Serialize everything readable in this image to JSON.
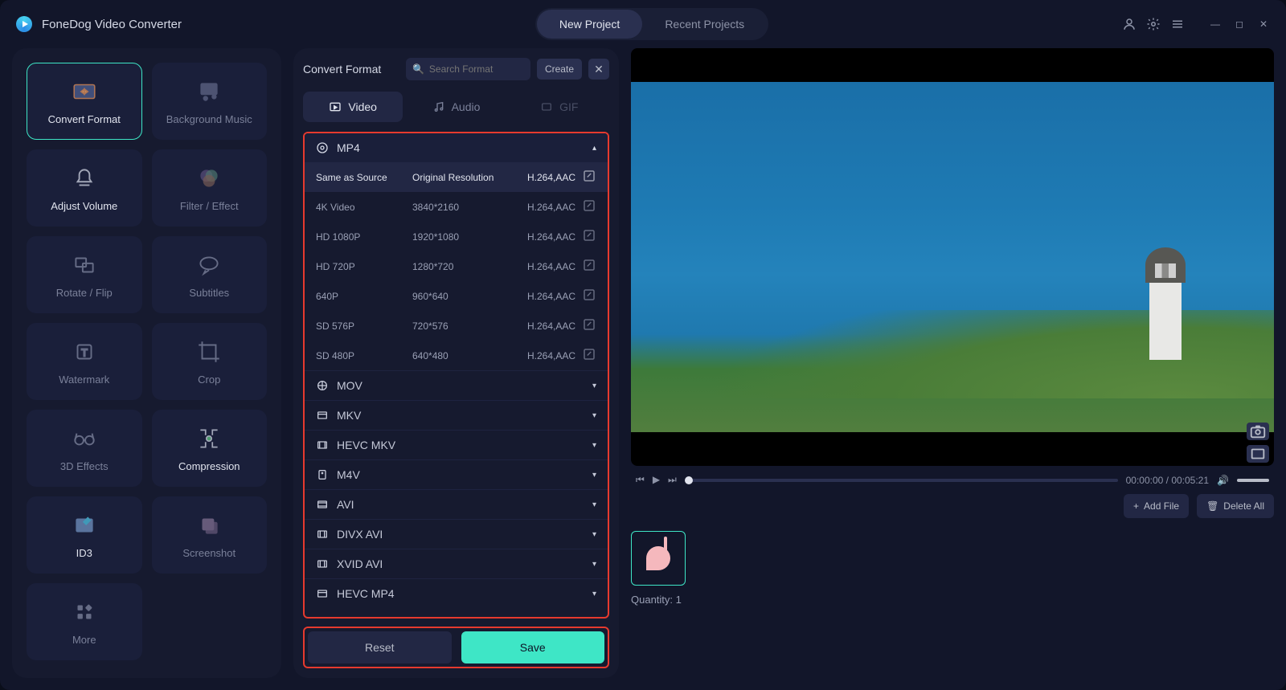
{
  "app": {
    "title": "FoneDog Video Converter"
  },
  "header": {
    "tabs": {
      "new": "New Project",
      "recent": "Recent Projects"
    }
  },
  "sidebar": {
    "items": [
      {
        "label": "Convert Format",
        "state": "active"
      },
      {
        "label": "Background Music",
        "state": ""
      },
      {
        "label": "Adjust Volume",
        "state": "highlight"
      },
      {
        "label": "Filter / Effect",
        "state": ""
      },
      {
        "label": "Rotate / Flip",
        "state": ""
      },
      {
        "label": "Subtitles",
        "state": ""
      },
      {
        "label": "Watermark",
        "state": ""
      },
      {
        "label": "Crop",
        "state": ""
      },
      {
        "label": "3D Effects",
        "state": ""
      },
      {
        "label": "Compression",
        "state": "highlight"
      },
      {
        "label": "ID3",
        "state": "highlight"
      },
      {
        "label": "Screenshot",
        "state": ""
      },
      {
        "label": "More",
        "state": ""
      }
    ]
  },
  "panel": {
    "title": "Convert Format",
    "search_placeholder": "Search Format",
    "create": "Create",
    "tabs": {
      "video": "Video",
      "audio": "Audio",
      "gif": "GIF"
    },
    "mp4_header": "MP4",
    "presets": [
      {
        "name": "Same as Source",
        "res": "Original Resolution",
        "codec": "H.264,AAC",
        "sel": true
      },
      {
        "name": "4K Video",
        "res": "3840*2160",
        "codec": "H.264,AAC",
        "sel": false
      },
      {
        "name": "HD 1080P",
        "res": "1920*1080",
        "codec": "H.264,AAC",
        "sel": false
      },
      {
        "name": "HD 720P",
        "res": "1280*720",
        "codec": "H.264,AAC",
        "sel": false
      },
      {
        "name": "640P",
        "res": "960*640",
        "codec": "H.264,AAC",
        "sel": false
      },
      {
        "name": "SD 576P",
        "res": "720*576",
        "codec": "H.264,AAC",
        "sel": false
      },
      {
        "name": "SD 480P",
        "res": "640*480",
        "codec": "H.264,AAC",
        "sel": false
      }
    ],
    "groups": [
      "MOV",
      "MKV",
      "HEVC MKV",
      "M4V",
      "AVI",
      "DIVX AVI",
      "XVID AVI",
      "HEVC MP4"
    ],
    "reset": "Reset",
    "save": "Save"
  },
  "player": {
    "time": "00:00:00 / 00:05:21"
  },
  "files": {
    "add": "Add File",
    "delete": "Delete All",
    "quantity_label": "Quantity: 1"
  }
}
